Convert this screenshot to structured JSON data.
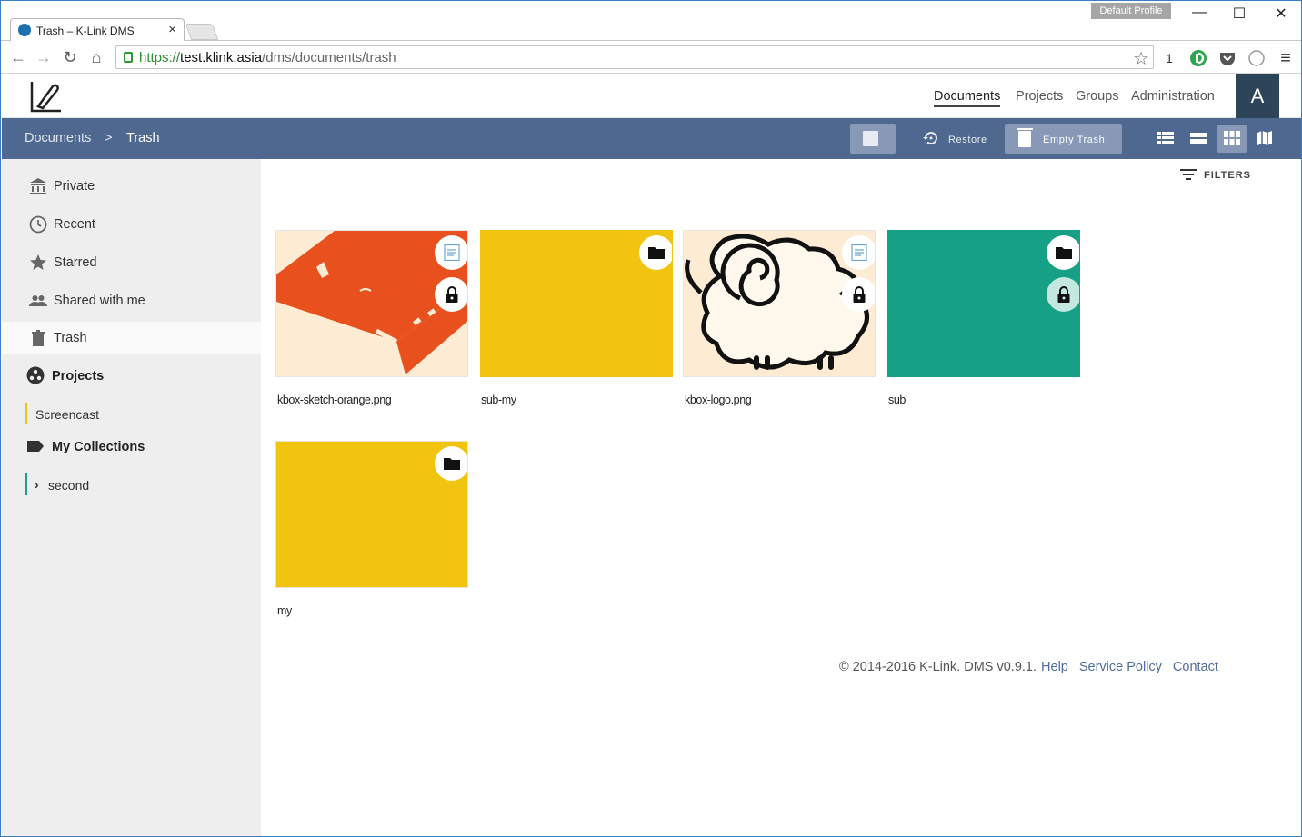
{
  "browser": {
    "tab_title": "Trash – K-Link DMS",
    "tab_close": "×",
    "profile_label": "Default Profile",
    "url_scheme": "https://",
    "url_host": "test.klink.asia",
    "url_path": "/dms/documents/trash",
    "extension_badge": "1",
    "controls": {
      "minimize": "—",
      "maximize": "☐",
      "close": "✕"
    },
    "nav": {
      "back": "←",
      "forward": "→",
      "reload": "↻",
      "home": "⌂",
      "star": "☆",
      "menu": "≡"
    }
  },
  "header": {
    "nav": [
      {
        "label": "Documents",
        "active": true
      },
      {
        "label": "Projects",
        "active": false
      },
      {
        "label": "Groups",
        "active": false
      },
      {
        "label": "Administration",
        "active": false
      }
    ],
    "avatar_initial": "A"
  },
  "actionbar": {
    "breadcrumb": [
      "Documents",
      "Trash"
    ],
    "breadcrumb_separator": ">",
    "restore_label": "Restore",
    "empty_trash_label": "Empty Trash",
    "views": [
      "list-view-icon",
      "rows-view-icon",
      "grid-view-icon",
      "map-view-icon"
    ],
    "active_view": "grid-view-icon"
  },
  "sidebar": {
    "items": [
      {
        "label": "Private",
        "icon": "bank-icon"
      },
      {
        "label": "Recent",
        "icon": "clock-icon"
      },
      {
        "label": "Starred",
        "icon": "star-icon"
      },
      {
        "label": "Shared with me",
        "icon": "people-icon"
      },
      {
        "label": "Trash",
        "icon": "trash-icon",
        "active": true
      }
    ],
    "projects_heading": "Projects",
    "projects": [
      {
        "label": "Screencast",
        "color": "#f1c40f"
      }
    ],
    "collections_heading": "My Collections",
    "collections": [
      {
        "label": "second",
        "color": "#16a085",
        "expandable": true
      }
    ]
  },
  "filters_label": "FILTERS",
  "items": [
    {
      "name": "kbox-sketch-orange.png",
      "kind": "document",
      "thumbnail": "orange-box-image",
      "locked": true
    },
    {
      "name": "sub-my",
      "kind": "folder",
      "color": "#f1c40f",
      "locked": false
    },
    {
      "name": "kbox-logo.png",
      "kind": "document",
      "thumbnail": "sheep-image",
      "locked": true
    },
    {
      "name": "sub",
      "kind": "folder",
      "color": "#16a085",
      "locked": true
    },
    {
      "name": "my",
      "kind": "folder",
      "color": "#f1c40f",
      "locked": false
    }
  ],
  "footer": {
    "copyright": "© 2014-2016 K-Link. DMS v0.9.1.",
    "links": [
      "Help",
      "Service Policy",
      "Contact"
    ]
  },
  "colors": {
    "actionbar": "#4f6890",
    "active_button": "#8799b7",
    "avatar": "#2d4459",
    "link": "#4f6d9c",
    "yellow": "#f1c40f",
    "teal": "#16a085",
    "orange": "#e8501e",
    "cream": "#fdebd3"
  }
}
